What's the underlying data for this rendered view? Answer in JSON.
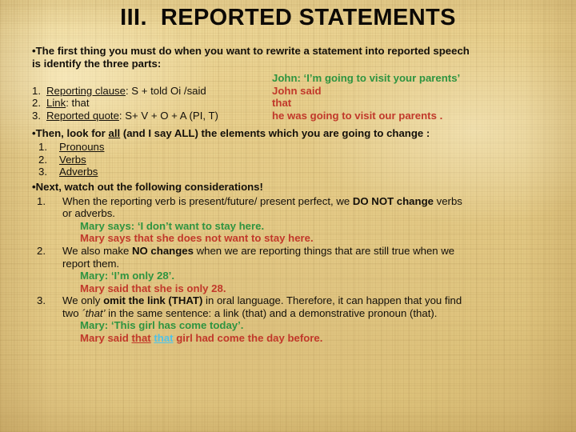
{
  "slide": {
    "title": "III.  REPORTED STATEMENTS",
    "colors": {
      "background": "#e8d08c",
      "title": "#0d0a06",
      "body": "#14100a",
      "quote_green": "#2e9440",
      "reported_red": "#c1382a",
      "demonstrative_cyan": "#4fc3e8"
    },
    "intro": {
      "bullet_char": "•",
      "line1": "The first thing you must do when you want to rewrite a statement into reported speech",
      "line2": "is identify the three parts:"
    },
    "parts": {
      "example_heading": "John: ‘I’m going to visit your parents’",
      "rows": [
        {
          "num": "1.",
          "term": "Reporting clause",
          "formula": ":  S + told Oi /said",
          "example": "John said"
        },
        {
          "num": "2.",
          "term": "Link",
          "formula": ": that",
          "example": "that"
        },
        {
          "num": "3.",
          "term": "Reported quote",
          "formula": ": S+ V + O + A (PI, T)",
          "example": "he was going to visit our parents ."
        }
      ]
    },
    "elements_section": {
      "bullet_char": "•",
      "lead_before": "Then, look for ",
      "lead_emphasis": "all",
      "lead_after": " (and I say ALL) the elements which you are going to change :",
      "items": [
        {
          "num": "1.",
          "label": "Pronouns"
        },
        {
          "num": "2.",
          "label": "Verbs"
        },
        {
          "num": "3.",
          "label": "Adverbs"
        }
      ]
    },
    "considerations": {
      "bullet_char": "•",
      "heading": "Next, watch out the following considerations!",
      "items": [
        {
          "num": "1.",
          "text_a": "When the reporting verb is present/future/ present perfect, we ",
          "bold_a": "DO NOT change",
          "text_b": " verbs",
          "text_c": "or adverbs.",
          "example_quote": "Mary says:  ‘I don’t want to stay here.",
          "example_reported": "Mary says that she does not want to stay here."
        },
        {
          "num": "2.",
          "text_a": "We also make ",
          "bold_a": "NO changes",
          "text_b": " when we are reporting things that are still true when we",
          "text_c": "report them.",
          "example_quote": "Mary:  ‘I’m only 28’.",
          "example_reported": "Mary said that she is only 28."
        },
        {
          "num": "3.",
          "text_a": "We only ",
          "bold_a": "omit the link (THAT)",
          "text_b": " in oral language.  Therefore, it can happen that you find",
          "line2_a": "two ",
          "line2_italic": "´that’",
          "line2_b": " in the same sentence: a link (that) and a demonstrative pronoun (that).",
          "example_quote": "Mary:  ‘This girl has come today’.",
          "reported_prefix": "Mary said ",
          "reported_that_link": "that",
          "reported_space": " ",
          "reported_that_demo": "that",
          "reported_suffix": " girl had come the day before."
        }
      ]
    }
  }
}
